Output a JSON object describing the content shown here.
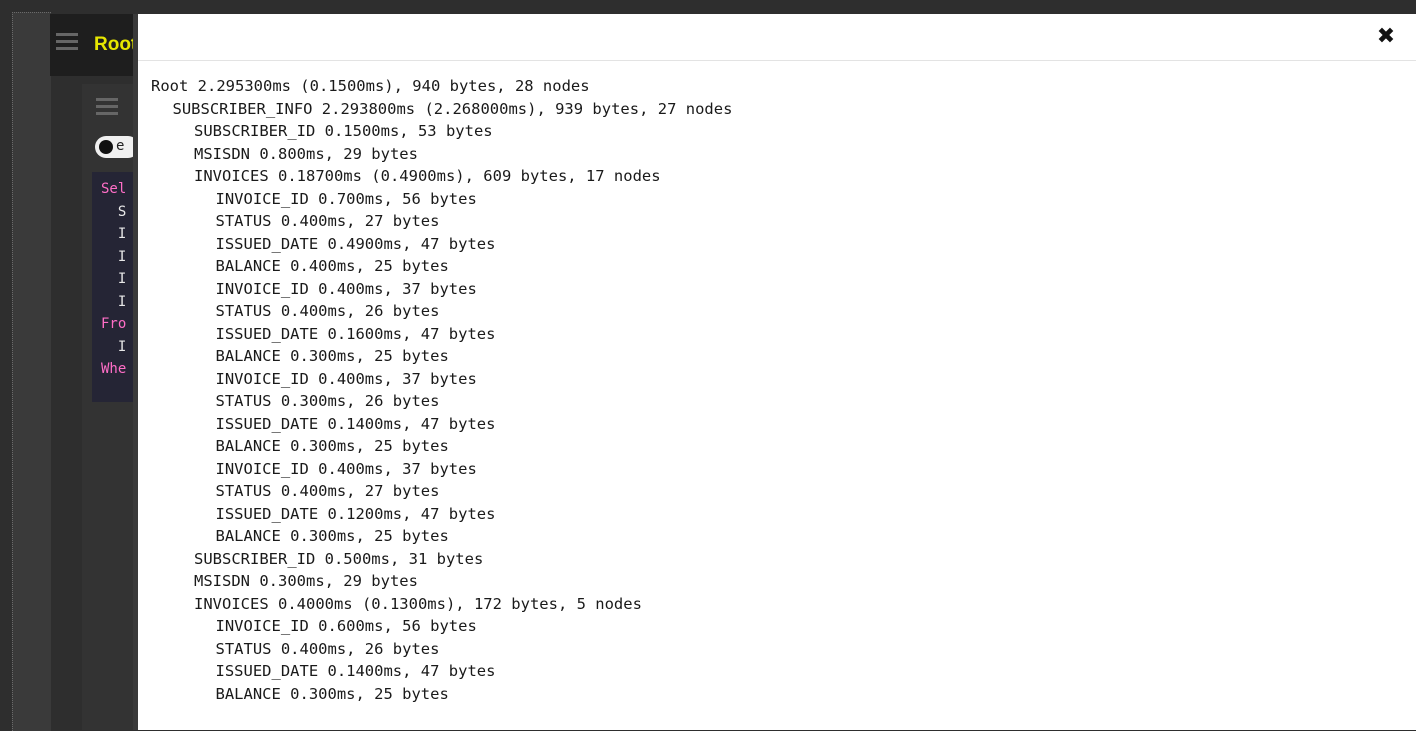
{
  "background": {
    "root_label": "Root",
    "toggle_text": "e",
    "code_lines": [
      {
        "kind": "kw",
        "text": "Sel"
      },
      {
        "kind": "id",
        "text": "  S"
      },
      {
        "kind": "id",
        "text": "  I"
      },
      {
        "kind": "id",
        "text": "  I"
      },
      {
        "kind": "id",
        "text": "  I"
      },
      {
        "kind": "id",
        "text": "  I"
      },
      {
        "kind": "kw",
        "text": "Fro"
      },
      {
        "kind": "id",
        "text": "  I"
      },
      {
        "kind": "id",
        "text": ""
      },
      {
        "kind": "kw",
        "text": "Whe"
      }
    ]
  },
  "modal": {
    "close_glyph": "✖",
    "lines": [
      {
        "indent": 0,
        "text": "Root 2.295300ms (0.1500ms), 940 bytes, 28 nodes"
      },
      {
        "indent": 1,
        "text": "SUBSCRIBER_INFO 2.293800ms (2.268000ms), 939 bytes, 27 nodes"
      },
      {
        "indent": 2,
        "text": "SUBSCRIBER_ID 0.1500ms, 53 bytes"
      },
      {
        "indent": 2,
        "text": "MSISDN 0.800ms, 29 bytes"
      },
      {
        "indent": 2,
        "text": "INVOICES 0.18700ms (0.4900ms), 609 bytes, 17 nodes"
      },
      {
        "indent": 3,
        "text": "INVOICE_ID 0.700ms, 56 bytes"
      },
      {
        "indent": 3,
        "text": "STATUS 0.400ms, 27 bytes"
      },
      {
        "indent": 3,
        "text": "ISSUED_DATE 0.4900ms, 47 bytes"
      },
      {
        "indent": 3,
        "text": "BALANCE 0.400ms, 25 bytes"
      },
      {
        "indent": 3,
        "text": "INVOICE_ID 0.400ms, 37 bytes"
      },
      {
        "indent": 3,
        "text": "STATUS 0.400ms, 26 bytes"
      },
      {
        "indent": 3,
        "text": "ISSUED_DATE 0.1600ms, 47 bytes"
      },
      {
        "indent": 3,
        "text": "BALANCE 0.300ms, 25 bytes"
      },
      {
        "indent": 3,
        "text": "INVOICE_ID 0.400ms, 37 bytes"
      },
      {
        "indent": 3,
        "text": "STATUS 0.300ms, 26 bytes"
      },
      {
        "indent": 3,
        "text": "ISSUED_DATE 0.1400ms, 47 bytes"
      },
      {
        "indent": 3,
        "text": "BALANCE 0.300ms, 25 bytes"
      },
      {
        "indent": 3,
        "text": "INVOICE_ID 0.400ms, 37 bytes"
      },
      {
        "indent": 3,
        "text": "STATUS 0.400ms, 27 bytes"
      },
      {
        "indent": 3,
        "text": "ISSUED_DATE 0.1200ms, 47 bytes"
      },
      {
        "indent": 3,
        "text": "BALANCE 0.300ms, 25 bytes"
      },
      {
        "indent": 2,
        "text": "SUBSCRIBER_ID 0.500ms, 31 bytes"
      },
      {
        "indent": 2,
        "text": "MSISDN 0.300ms, 29 bytes"
      },
      {
        "indent": 2,
        "text": "INVOICES 0.4000ms (0.1300ms), 172 bytes, 5 nodes"
      },
      {
        "indent": 3,
        "text": "INVOICE_ID 0.600ms, 56 bytes"
      },
      {
        "indent": 3,
        "text": "STATUS 0.400ms, 26 bytes"
      },
      {
        "indent": 3,
        "text": "ISSUED_DATE 0.1400ms, 47 bytes"
      },
      {
        "indent": 3,
        "text": "BALANCE 0.300ms, 25 bytes"
      }
    ]
  }
}
